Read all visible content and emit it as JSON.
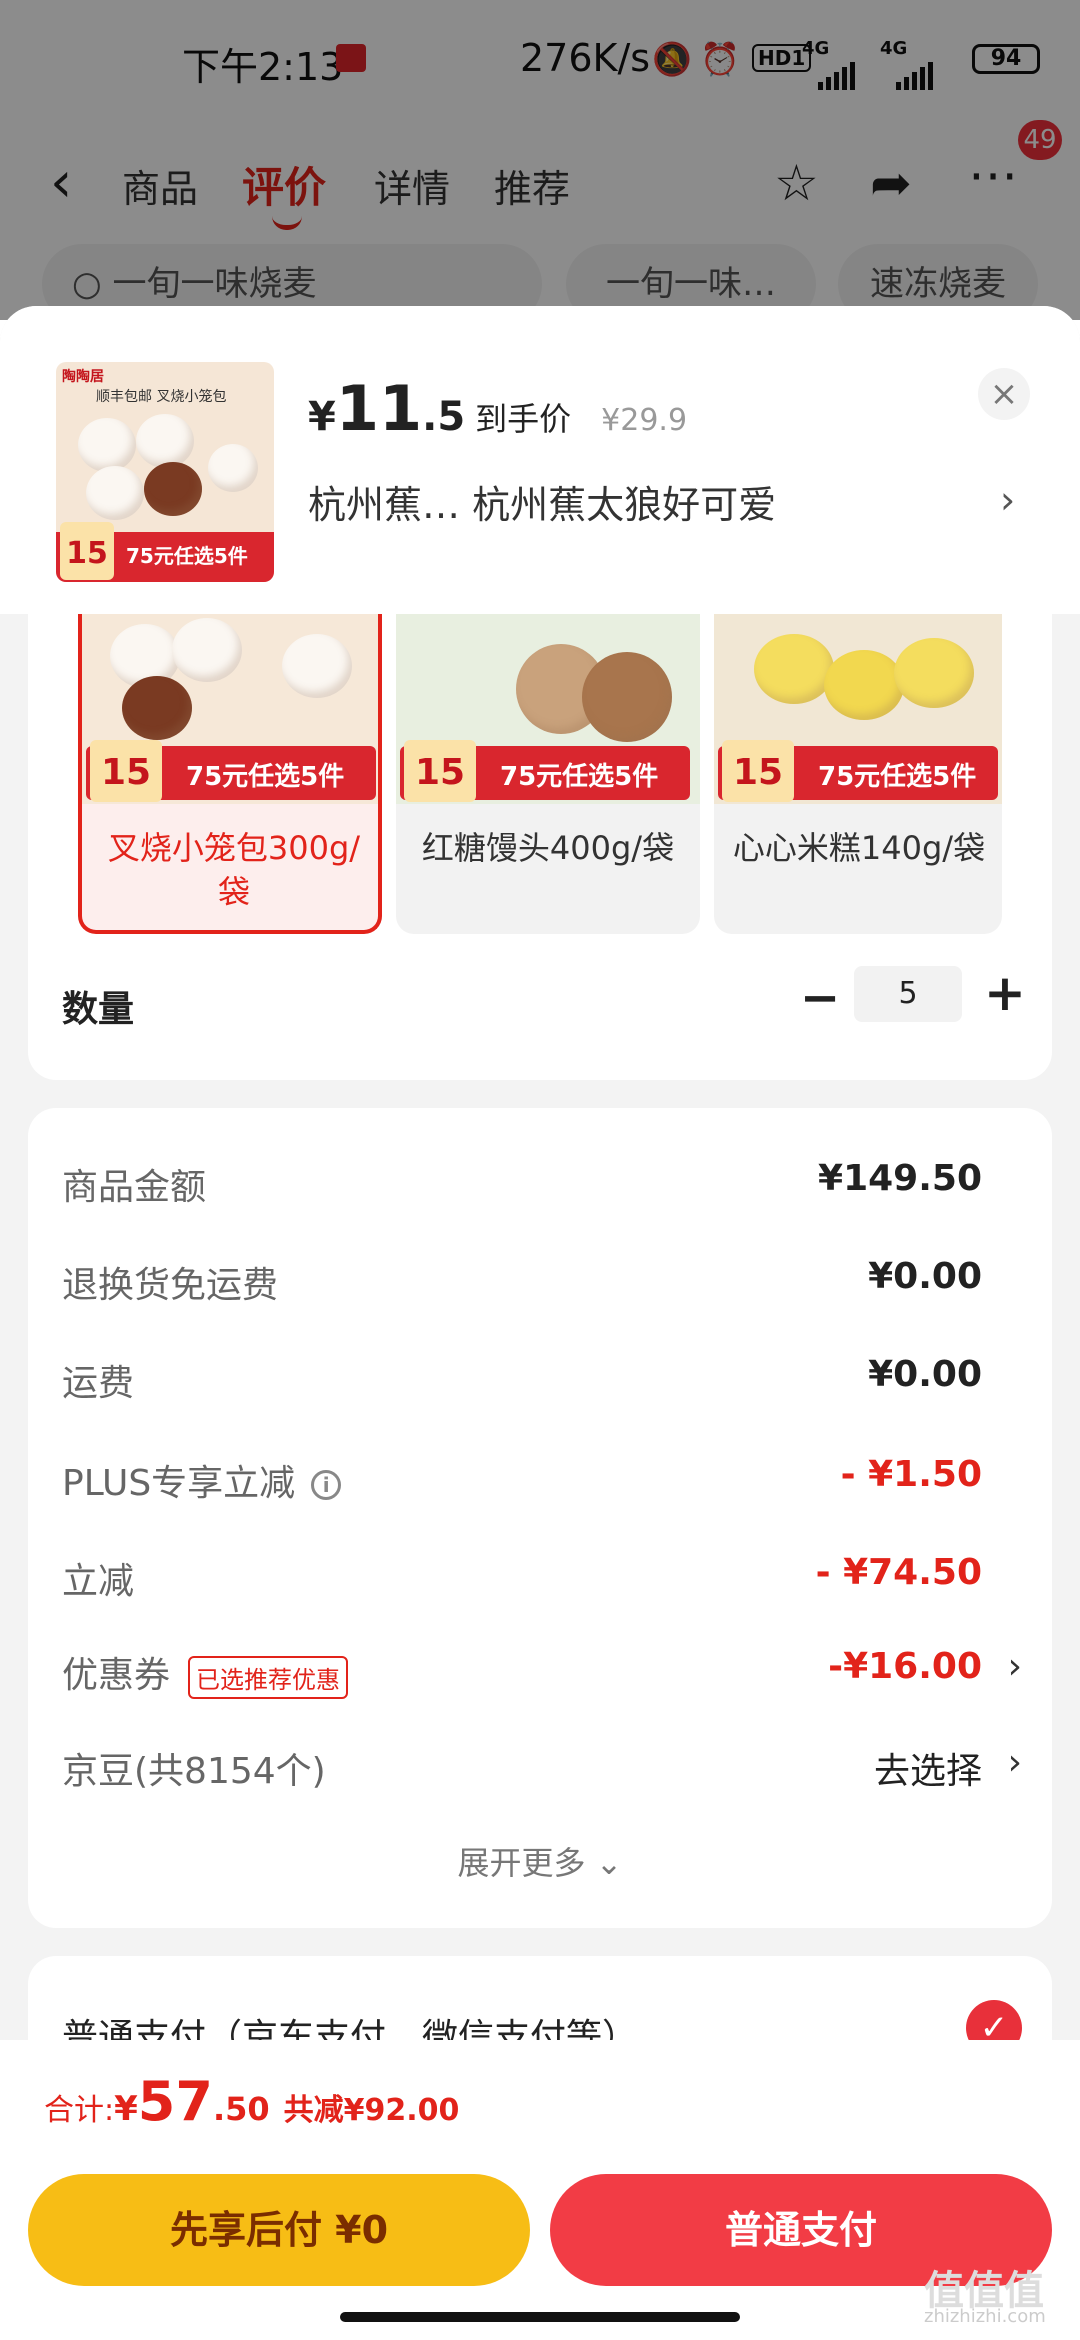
{
  "status": {
    "time": "下午2:13",
    "net": "276K/s",
    "hd": "HD1",
    "net1": "4G",
    "net2": "4G",
    "battery": "94"
  },
  "nav": {
    "back": "‹",
    "tabs": [
      "商品",
      "评价",
      "详情",
      "推荐"
    ],
    "active": "评价",
    "badge": "49"
  },
  "search": {
    "query": "一旬一味烧麦",
    "chip1": "一旬一味…",
    "chip2": "速冻烧麦"
  },
  "product": {
    "currency": "¥",
    "price_int": "11",
    "price_dec": ".5",
    "price_label": "到手价",
    "orig": "¥29.9",
    "name": "杭州蕉…  杭州蕉太狼好可爱",
    "close": "×",
    "chev": "›",
    "thumb_brand": "陶陶居",
    "thumb_top": "顺丰包邮  叉烧小笼包",
    "thumb_num": "15",
    "thumb_promo": "75元任选5件"
  },
  "skus": [
    {
      "label": "叉烧小笼包300g/袋",
      "num": "15",
      "promo": "75元任选5件",
      "selected": true
    },
    {
      "label": "红糖馒头400g/袋",
      "num": "15",
      "promo": "75元任选5件",
      "selected": false
    },
    {
      "label": "心心米糕140g/袋",
      "num": "15",
      "promo": "75元任选5件",
      "selected": false
    }
  ],
  "quantity": {
    "label": "数量",
    "value": "5",
    "minus": "−",
    "plus": "+"
  },
  "summary": [
    {
      "key": "商品金额",
      "value": "¥149.50"
    },
    {
      "key": "退换货免运费",
      "value": "¥0.00"
    },
    {
      "key": "运费",
      "value": "¥0.00"
    },
    {
      "key": "PLUS专享立减",
      "value": "- ¥1.50"
    },
    {
      "key": "立减",
      "value": "- ¥74.50"
    },
    {
      "key": "优惠券",
      "tag": "已选推荐优惠",
      "value": "-¥16.00"
    },
    {
      "key": "京豆(共8154个)",
      "value": "去选择"
    }
  ],
  "expand": "展开更多 ⌄",
  "payment": {
    "method": "普通支付（京东支付、微信支付等）"
  },
  "bottom": {
    "total_label": "合计:",
    "currency": "¥",
    "total_int": "57",
    "total_dec": ".50",
    "saved": "共减¥92.00",
    "btn_later": "先享后付 ¥0",
    "btn_pay": "普通支付"
  },
  "watermark": {
    "logo": "值值值",
    "url": "zhizhizhi.com"
  },
  "colors": {
    "accent": "#e2231a",
    "later": "#f7bd15",
    "pay": "#f23c45"
  }
}
